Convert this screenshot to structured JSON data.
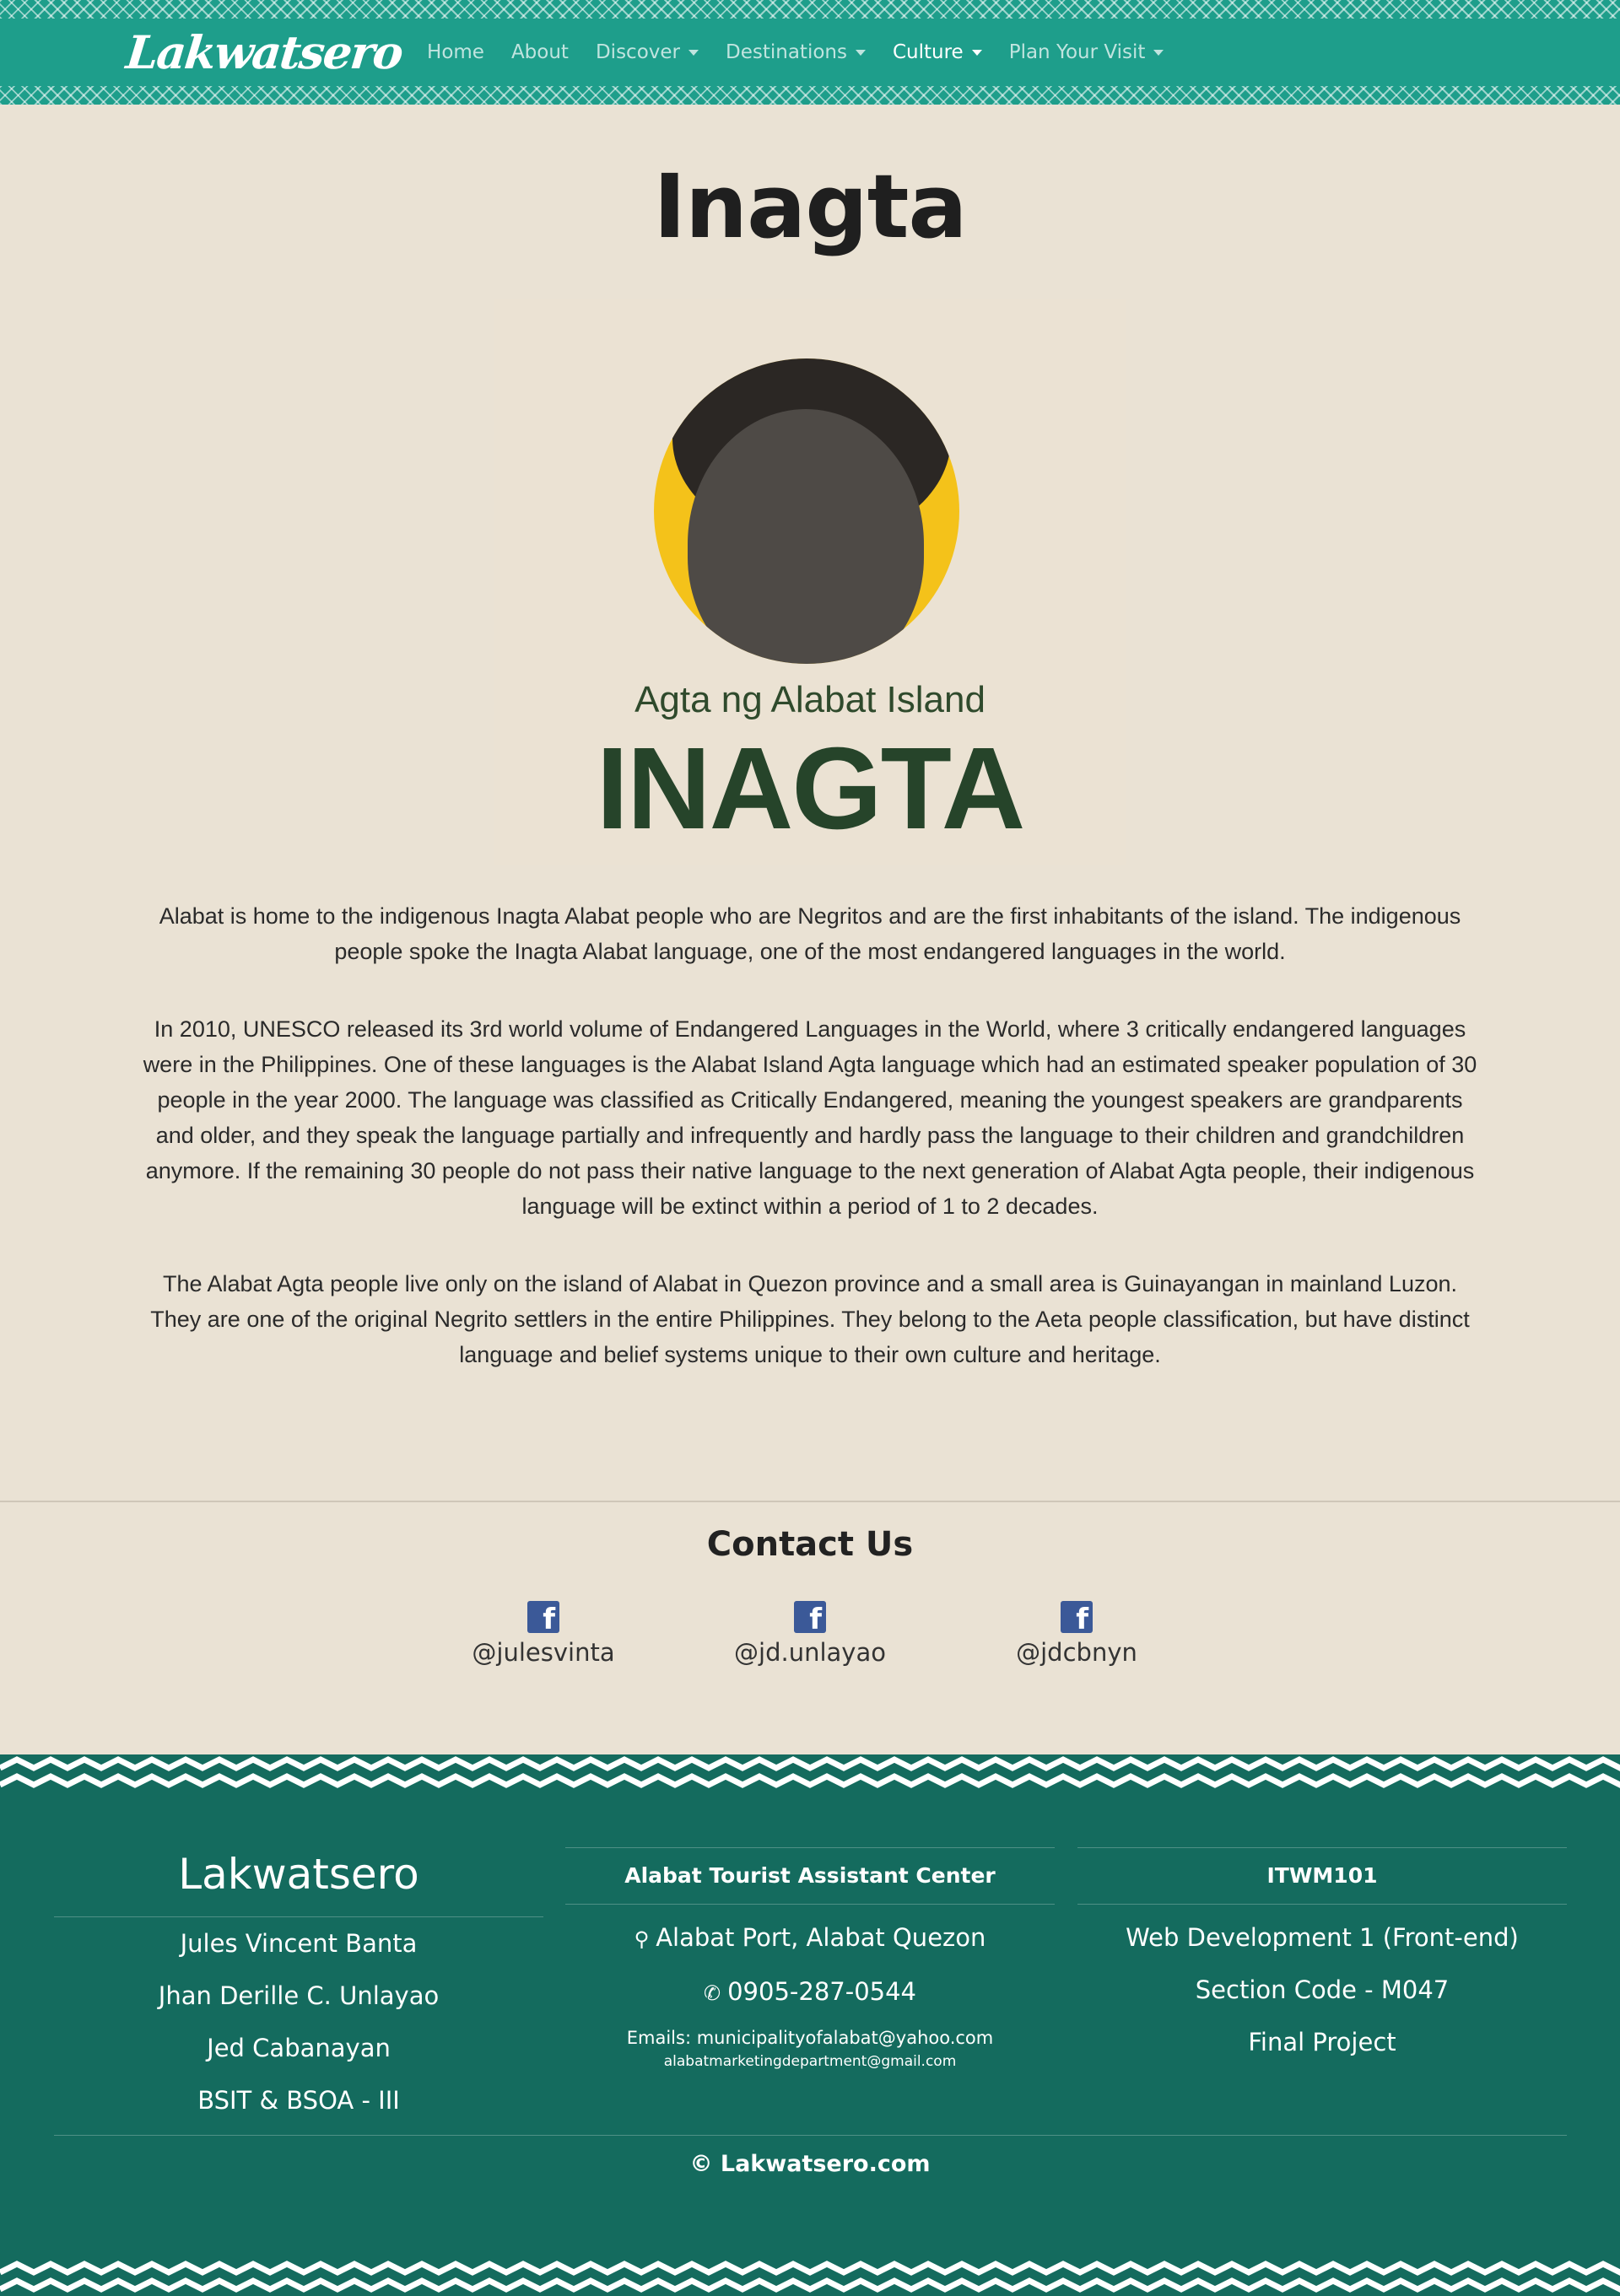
{
  "nav": {
    "brand": "Lakwatsero",
    "links": [
      {
        "label": "Home",
        "dropdown": false,
        "active": false
      },
      {
        "label": "About",
        "dropdown": false,
        "active": false
      },
      {
        "label": "Discover",
        "dropdown": true,
        "active": false
      },
      {
        "label": "Destinations",
        "dropdown": true,
        "active": false
      },
      {
        "label": "Culture",
        "dropdown": true,
        "active": true
      },
      {
        "label": "Plan Your Visit",
        "dropdown": true,
        "active": false
      }
    ]
  },
  "main": {
    "title": "Inagta",
    "hero": {
      "subtitle": "Agta ng Alabat Island",
      "big_text": "INAGTA"
    },
    "paragraphs": [
      "Alabat is home to the indigenous Inagta Alabat people who are Negritos and are the first inhabitants of the island. The indigenous people spoke the Inagta Alabat language, one of the most endangered languages in the world.",
      "In 2010, UNESCO released its 3rd world volume of Endangered Languages in the World, where 3 critically endangered languages were in the Philippines. One of these languages is the Alabat Island Agta language which had an estimated speaker population of 30 people in the year 2000. The language was classified as Critically Endangered, meaning the youngest speakers are grandparents and older, and they speak the language partially and infrequently and hardly pass the language to their children and grandchildren anymore. If the remaining 30 people do not pass their native language to the next generation of Alabat Agta people, their indigenous language will be extinct within a period of 1 to 2 decades.",
      "The Alabat Agta people live only on the island of Alabat in Quezon province and a small area is Guinayangan in mainland Luzon. They are one of the original Negrito settlers in the entire Philippines. They belong to the Aeta people classification, but have distinct language and belief systems unique to their own culture and heritage."
    ]
  },
  "contact": {
    "title": "Contact Us",
    "items": [
      {
        "icon": "facebook-icon",
        "handle": "@julesvinta"
      },
      {
        "icon": "facebook-icon",
        "handle": "@jd.unlayao"
      },
      {
        "icon": "facebook-icon",
        "handle": "@jdcbnyn"
      }
    ]
  },
  "footer": {
    "brand": "Lakwatsero",
    "members": [
      "Jules Vincent Banta",
      "Jhan Derille C. Unlayao",
      "Jed Cabanayan",
      "BSIT & BSOA - III"
    ],
    "center": {
      "heading": "Alabat Tourist Assistant Center",
      "address": "Alabat Port, Alabat Quezon",
      "phone": "0905-287-0544",
      "email1": "Emails: municipalityofalabat@yahoo.com",
      "email2": "alabatmarketingdepartment@gmail.com"
    },
    "course": {
      "heading": "ITWM101",
      "lines": [
        "Web Development 1 (Front-end)",
        "Section Code - M047",
        "Final Project"
      ]
    },
    "copyright": "© Lakwatsero.com"
  },
  "colors": {
    "nav_bg": "#1e9e8b",
    "page_bg": "#eae2d4",
    "footer_bg": "#146b5e",
    "hero_accent": "#f4c21a",
    "hero_text": "#26442a",
    "facebook": "#3b5998"
  }
}
